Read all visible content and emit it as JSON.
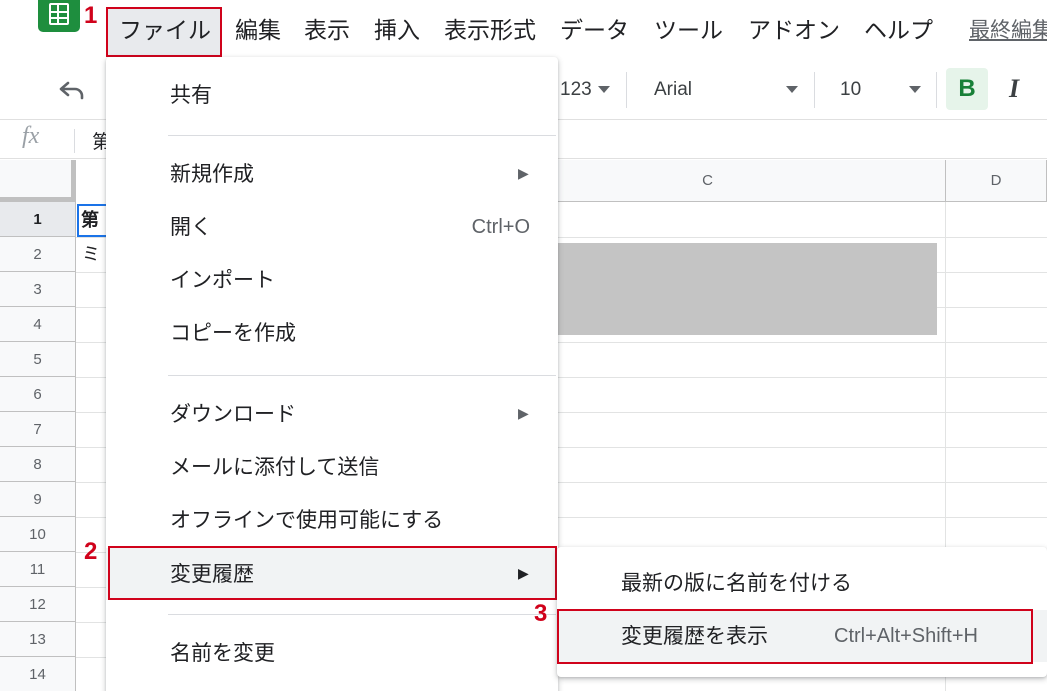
{
  "menubar": {
    "logo": "sheets-logo-icon",
    "items": [
      "ファイル",
      "編集",
      "表示",
      "挿入",
      "表示形式",
      "データ",
      "ツール",
      "アドオン",
      "ヘルプ"
    ],
    "last_edit": "最終編集"
  },
  "steps": {
    "one": "1",
    "two": "2",
    "three": "3"
  },
  "toolbar": {
    "undo_icon": "undo-icon",
    "number_format": "123",
    "font": "Arial",
    "font_size": "10",
    "bold": "B",
    "italic": "I"
  },
  "formula_bar": {
    "fx": "fx",
    "value": "第"
  },
  "grid": {
    "columns": [
      "C",
      "D"
    ],
    "rows": [
      "1",
      "2",
      "3",
      "4",
      "5",
      "6",
      "7",
      "8",
      "9",
      "10",
      "11",
      "12",
      "13",
      "14"
    ],
    "a1": "第",
    "a2": "ミ"
  },
  "file_menu": {
    "share": "共有",
    "new": "新規作成",
    "open": "開く",
    "open_shortcut": "Ctrl+O",
    "import": "インポート",
    "make_copy": "コピーを作成",
    "download": "ダウンロード",
    "email_attachment": "メールに添付して送信",
    "offline": "オフラインで使用可能にする",
    "version_history": "変更履歴",
    "rename": "名前を変更",
    "submenu_arrow": "▶"
  },
  "version_submenu": {
    "name_version": "最新の版に名前を付ける",
    "see_history": "変更履歴を表示",
    "see_history_shortcut": "Ctrl+Alt+Shift+H"
  },
  "colors": {
    "accent_red": "#d0021b",
    "sheets_green": "#1e8e3e",
    "selection_blue": "#1a73e8"
  }
}
